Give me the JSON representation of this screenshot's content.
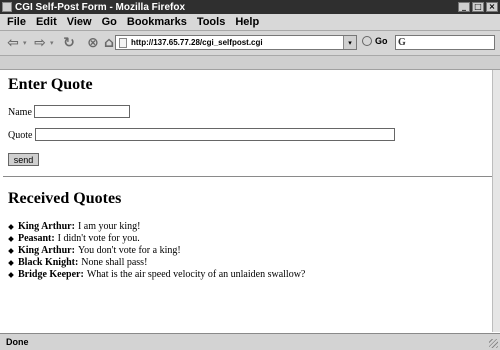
{
  "window": {
    "title": "CGI Self-Post Form - Mozilla Firefox"
  },
  "menu": {
    "items": [
      "File",
      "Edit",
      "View",
      "Go",
      "Bookmarks",
      "Tools",
      "Help"
    ]
  },
  "toolbar": {
    "url": "http://137.65.77.28/cgi_selfpost.cgi",
    "go_label": "Go",
    "search_icon_text": "G"
  },
  "form": {
    "heading": "Enter Quote",
    "name_label": "Name",
    "name_value": "",
    "quote_label": "Quote",
    "quote_value": "",
    "send_label": "send"
  },
  "received": {
    "heading": "Received Quotes",
    "quotes": [
      {
        "speaker": "King Arthur:",
        "text": "I am your king!"
      },
      {
        "speaker": "Peasant:",
        "text": "I didn't vote for you."
      },
      {
        "speaker": "King Arthur:",
        "text": "You don't vote for a king!"
      },
      {
        "speaker": "Black Knight:",
        "text": "None shall pass!"
      },
      {
        "speaker": "Bridge Keeper:",
        "text": "What is the air speed velocity of an unlaiden swallow?"
      }
    ]
  },
  "status": {
    "text": "Done"
  }
}
